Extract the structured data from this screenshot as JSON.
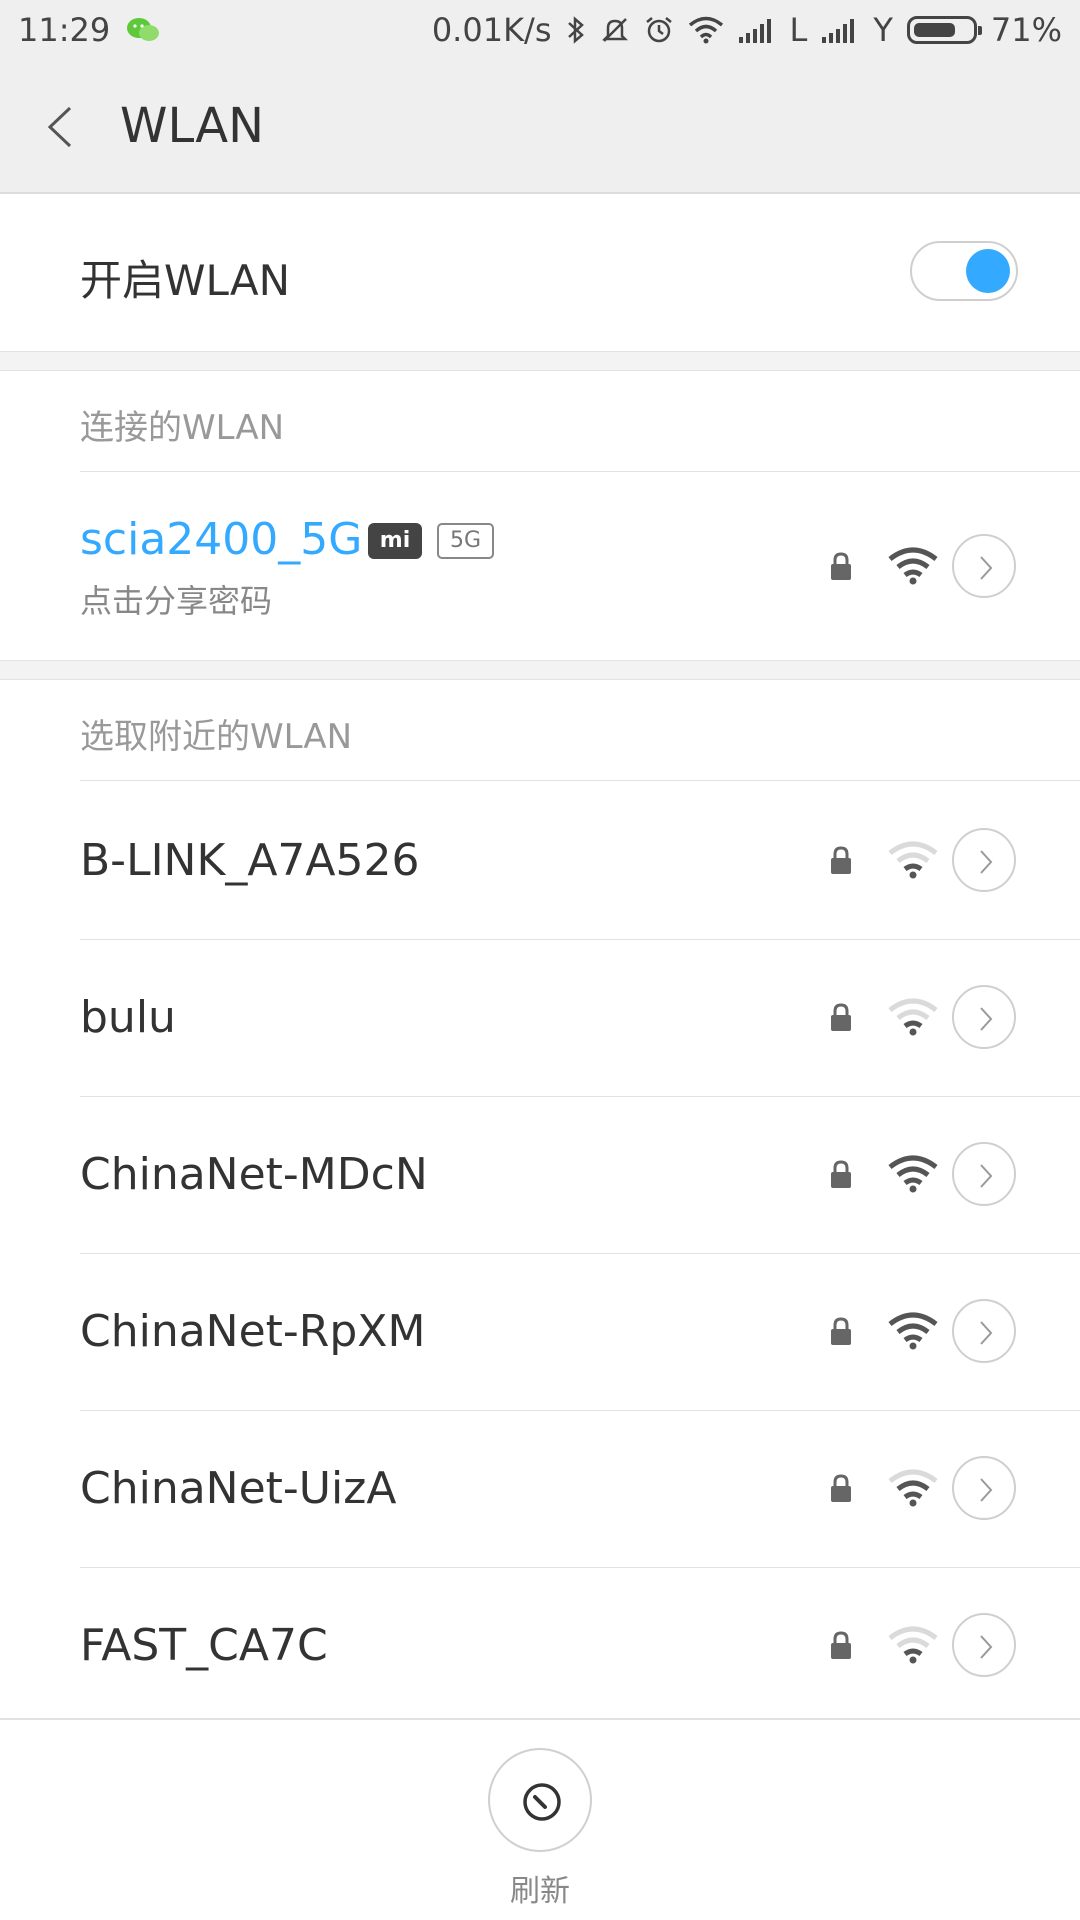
{
  "status_bar": {
    "time": "11:29",
    "speed": "0.01K/s",
    "sim1_label": "L",
    "sim2_label": "Y",
    "battery_percent": "71%",
    "battery_level": 0.71
  },
  "header": {
    "title": "WLAN"
  },
  "toggle": {
    "label": "开启WLAN",
    "on": true,
    "accent": "#33aaff"
  },
  "connected_section": {
    "title": "连接的WLAN",
    "network": {
      "name": "scia2400_5G",
      "badge_mi": "mi",
      "badge_band": "5G",
      "subtitle": "点击分享密码",
      "secured": true,
      "signal": "strong"
    }
  },
  "nearby_section": {
    "title": "选取附近的WLAN",
    "networks": [
      {
        "name": "B-LINK_A7A526",
        "secured": true,
        "signal": "weak"
      },
      {
        "name": "bulu",
        "secured": true,
        "signal": "weak"
      },
      {
        "name": "ChinaNet-MDcN",
        "secured": true,
        "signal": "strong"
      },
      {
        "name": "ChinaNet-RpXM",
        "secured": true,
        "signal": "strong"
      },
      {
        "name": "ChinaNet-UizA",
        "secured": true,
        "signal": "medium"
      },
      {
        "name": "FAST_CA7C",
        "secured": true,
        "signal": "weak"
      }
    ]
  },
  "refresh": {
    "label": "刷新"
  }
}
